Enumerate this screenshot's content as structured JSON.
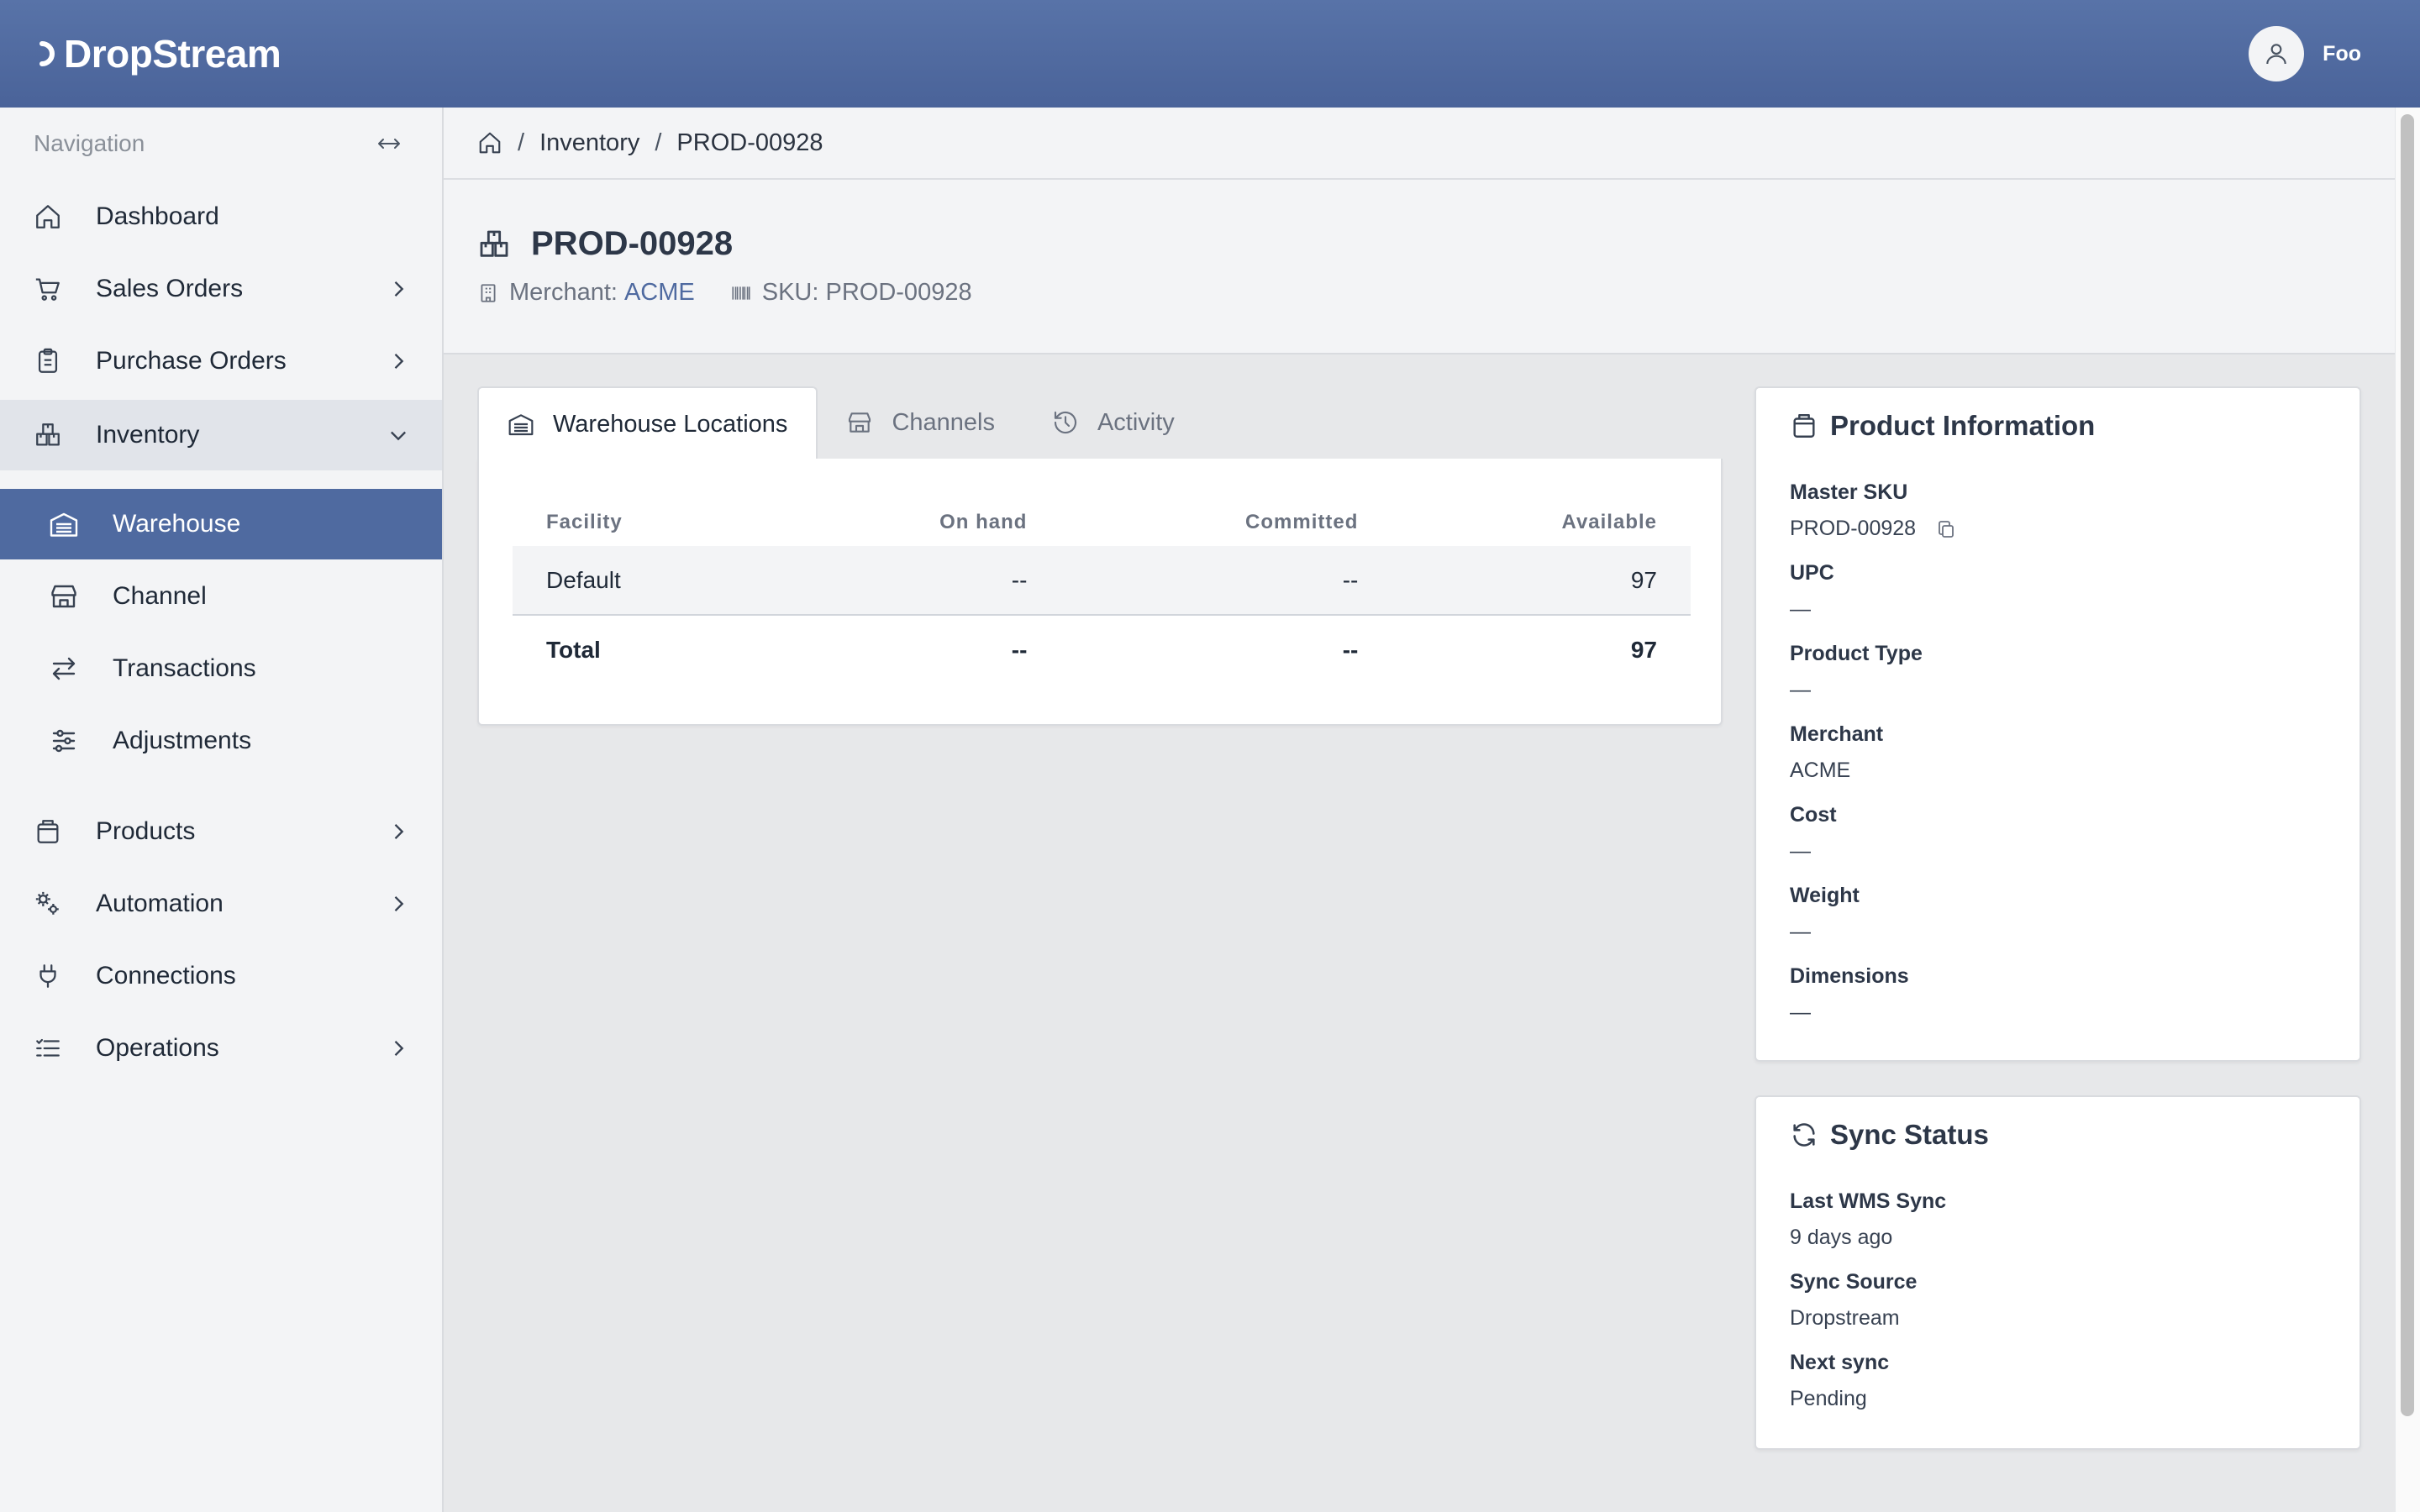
{
  "app": {
    "logo": "DropStream",
    "user_name": "Foo"
  },
  "sidebar": {
    "title": "Navigation",
    "items": [
      {
        "label": "Dashboard",
        "icon": "home-icon"
      },
      {
        "label": "Sales Orders",
        "icon": "cart-icon"
      },
      {
        "label": "Purchase Orders",
        "icon": "clipboard-icon"
      },
      {
        "label": "Inventory",
        "icon": "boxes-icon",
        "expanded": true
      },
      {
        "label": "Products",
        "icon": "package-icon"
      },
      {
        "label": "Automation",
        "icon": "cogs-icon"
      },
      {
        "label": "Connections",
        "icon": "plug-icon"
      },
      {
        "label": "Operations",
        "icon": "list-icon"
      }
    ],
    "inventory_sub": [
      {
        "label": "Warehouse",
        "icon": "warehouse-icon",
        "active": true
      },
      {
        "label": "Channel",
        "icon": "store-icon"
      },
      {
        "label": "Transactions",
        "icon": "arrows-icon"
      },
      {
        "label": "Adjustments",
        "icon": "sliders-icon"
      }
    ]
  },
  "breadcrumb": {
    "items": [
      "Inventory",
      "PROD-00928"
    ]
  },
  "page": {
    "title": "PROD-00928",
    "merchant_label": "Merchant:",
    "merchant_value": "ACME",
    "sku_label": "SKU: PROD-00928"
  },
  "tabs": [
    {
      "label": "Warehouse Locations",
      "icon": "warehouse-icon",
      "active": true
    },
    {
      "label": "Channels",
      "icon": "store-icon"
    },
    {
      "label": "Activity",
      "icon": "history-icon"
    }
  ],
  "table": {
    "headers": [
      "Facility",
      "On hand",
      "Committed",
      "Available"
    ],
    "rows": [
      [
        "Default",
        "--",
        "--",
        "97"
      ]
    ],
    "total": [
      "Total",
      "--",
      "--",
      "97"
    ]
  },
  "product_info": {
    "title": "Product Information",
    "fields": [
      {
        "label": "Master SKU",
        "value": "PROD-00928"
      },
      {
        "label": "UPC",
        "value": "—"
      },
      {
        "label": "Product Type",
        "value": "—"
      },
      {
        "label": "Merchant",
        "value": "ACME"
      },
      {
        "label": "Cost",
        "value": "—"
      },
      {
        "label": "Weight",
        "value": "—"
      },
      {
        "label": "Dimensions",
        "value": "—"
      }
    ]
  },
  "sync_status": {
    "title": "Sync Status",
    "fields": [
      {
        "label": "Last WMS Sync",
        "value": "9 days ago"
      },
      {
        "label": "Sync Source",
        "value": "Dropstream"
      },
      {
        "label": "Next sync",
        "value": "Pending"
      }
    ]
  },
  "colors": {
    "topbar": "#4f6aa0",
    "accent": "#4f6aa0",
    "sidebar_bg": "#f3f4f6",
    "active_item": "#4f6aa0"
  }
}
